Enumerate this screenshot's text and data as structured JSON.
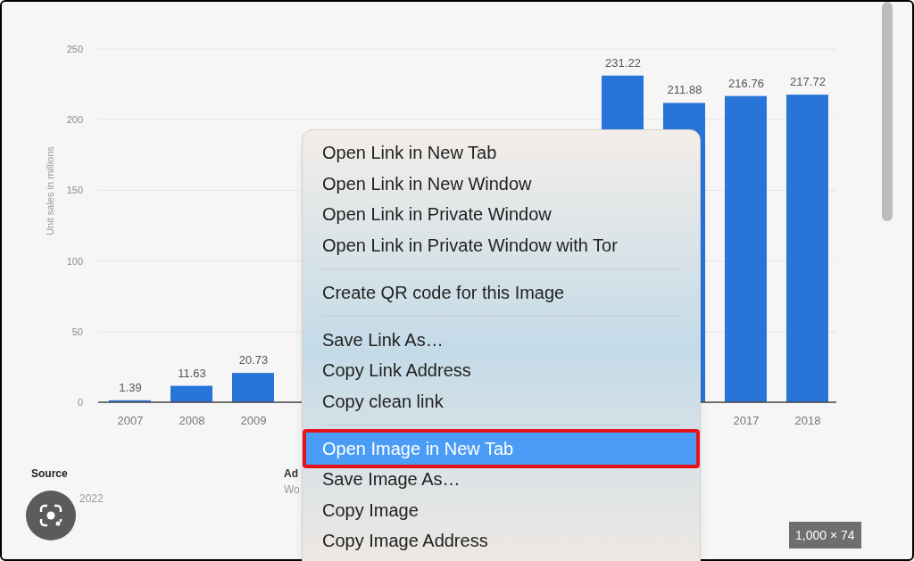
{
  "chart": {
    "chart_data": {
      "type": "bar",
      "ylabel": "Unit sales in millions",
      "categories": [
        "2007",
        "2008",
        "2009",
        null,
        null,
        null,
        null,
        null,
        null,
        null,
        "2017",
        "2018"
      ],
      "values": [
        1.39,
        11.63,
        20.73,
        null,
        null,
        null,
        null,
        null,
        231.22,
        211.88,
        216.76,
        217.72
      ],
      "value_labels": [
        "1.39",
        "11.63",
        "20.73",
        null,
        null,
        null,
        null,
        null,
        "231.22",
        "211.88",
        "216.76",
        "217.72"
      ],
      "ylim": [
        0,
        250
      ],
      "grid": true,
      "yticks": [
        0,
        50,
        100,
        150,
        200,
        250
      ]
    }
  },
  "footer": {
    "source_label": "Source",
    "source_year": "2022",
    "info_label": "Ad",
    "info_sub": "Wo"
  },
  "image_size": "1,000 × 74",
  "context_menu": [
    {
      "kind": "item",
      "label": "Open Link in New Tab",
      "selected": false
    },
    {
      "kind": "item",
      "label": "Open Link in New Window",
      "selected": false
    },
    {
      "kind": "item",
      "label": "Open Link in Private Window",
      "selected": false
    },
    {
      "kind": "item",
      "label": "Open Link in Private Window with Tor",
      "selected": false
    },
    {
      "kind": "separator"
    },
    {
      "kind": "item",
      "label": "Create QR code for this Image",
      "selected": false
    },
    {
      "kind": "separator"
    },
    {
      "kind": "item",
      "label": "Save Link As…",
      "selected": false
    },
    {
      "kind": "item",
      "label": "Copy Link Address",
      "selected": false
    },
    {
      "kind": "item",
      "label": "Copy clean link",
      "selected": false
    },
    {
      "kind": "separator"
    },
    {
      "kind": "item",
      "label": "Open Image in New Tab",
      "selected": true
    },
    {
      "kind": "item",
      "label": "Save Image As…",
      "selected": false
    },
    {
      "kind": "item",
      "label": "Copy Image",
      "selected": false
    },
    {
      "kind": "item",
      "label": "Copy Image Address",
      "selected": false
    }
  ]
}
